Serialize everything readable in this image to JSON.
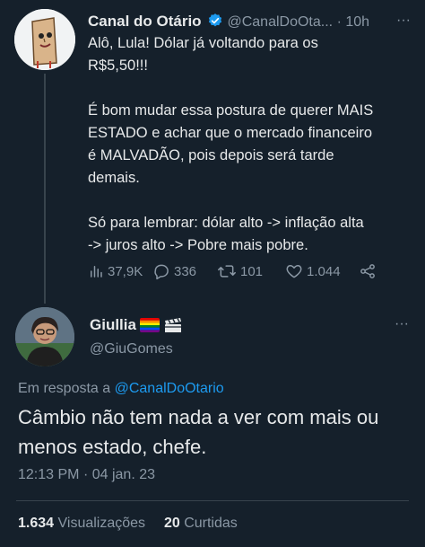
{
  "tweet": {
    "author_name": "Canal do Otário",
    "author_handle": "@CanalDoOta...",
    "separator": "·",
    "time": "10h",
    "more": "···",
    "text": "Alô, Lula! Dólar já voltando para os\nR$5,50!!!\n\nÉ bom mudar essa postura de querer MAIS\nESTADO e achar que o mercado financeiro\né MALVADÃO, pois depois será tarde\ndemais.\n\nSó para lembrar: dólar alto -> inflação alta\n-> juros alto -> Pobre mais pobre.",
    "views": "37,9K",
    "replies": "336",
    "retweets": "101",
    "likes": "1.044",
    "icons": [
      "verified-badge-icon",
      "views-icon",
      "reply-icon",
      "retweet-icon",
      "like-icon",
      "share-icon"
    ]
  },
  "reply": {
    "author_name": "Giullia",
    "author_handle": "@GiuGomes",
    "more": "···",
    "reply_prefix": "Em resposta a",
    "reply_mention": "@CanalDoOtario",
    "text": "Câmbio não tem nada a ver com mais ou menos estado, chefe.",
    "time": "12:13 PM",
    "date_separator": "·",
    "date": "04 jan. 23",
    "views_count": "1.634",
    "views_label": "Visualizações",
    "retweets_count": "20",
    "retweets_label": "Curtidas",
    "icons": [
      "rainbow-flag-icon",
      "clapperboard-icon"
    ]
  },
  "colors": {
    "background": "#15202b",
    "text": "#e7e9ea",
    "muted": "#8b98a5",
    "accent": "#1d9bf0",
    "divider": "#38444d"
  }
}
